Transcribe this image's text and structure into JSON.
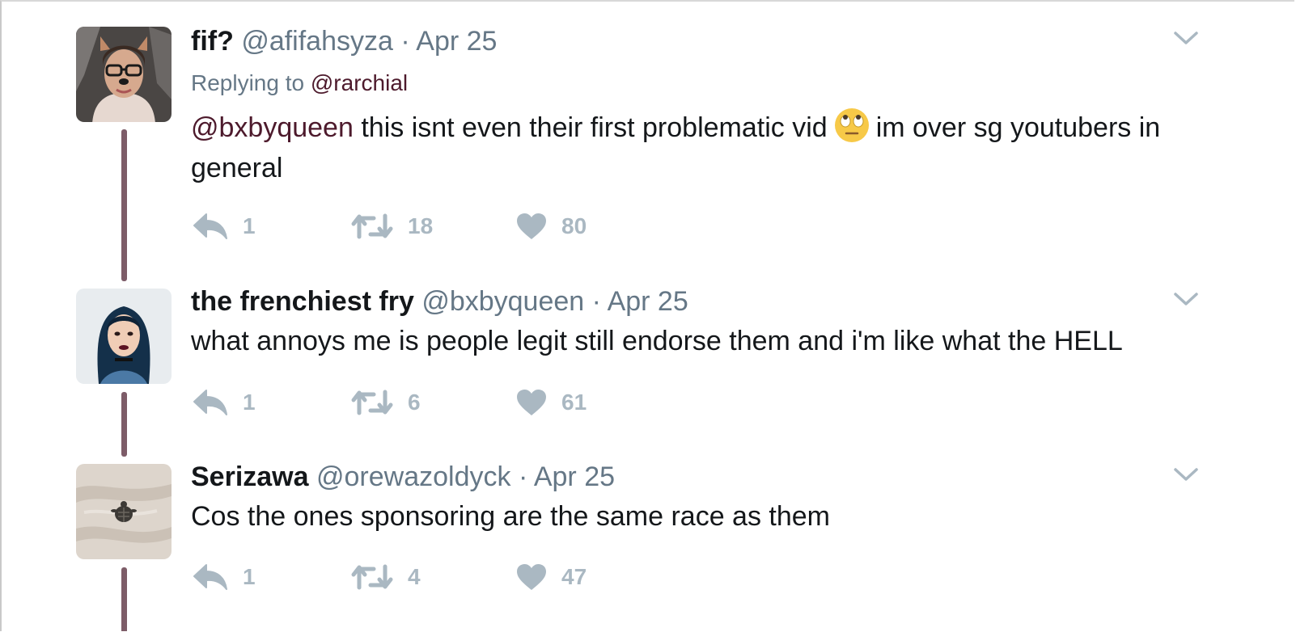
{
  "colors": {
    "mention": "#4d1a2c",
    "thread_line": "#7d5c68",
    "muted": "#657786",
    "action_gray": "#aab8c2"
  },
  "tweets": [
    {
      "name": "fif?",
      "handle": "@afifahsyza",
      "separator": "·",
      "date": "Apr 25",
      "replying_label": "Replying to",
      "replying_to": "@rarchial",
      "mention": "@bxbyqueen",
      "text_part1": " this isnt even their first problematic vid",
      "emoji": "face-with-rolling-eyes-emoji",
      "text_part2": "im over sg youtubers in general",
      "reply_count": "1",
      "retweet_count": "18",
      "like_count": "80"
    },
    {
      "name": "the frenchiest fry",
      "handle": "@bxbyqueen",
      "separator": "·",
      "date": "Apr 25",
      "text": "what annoys me is people legit still endorse them and i'm like what the HELL",
      "reply_count": "1",
      "retweet_count": "6",
      "like_count": "61"
    },
    {
      "name": "Serizawa",
      "handle": "@orewazoldyck",
      "separator": "·",
      "date": "Apr 25",
      "text": "Cos the ones sponsoring are the same race as them",
      "reply_count": "1",
      "retweet_count": "4",
      "like_count": "47"
    }
  ]
}
